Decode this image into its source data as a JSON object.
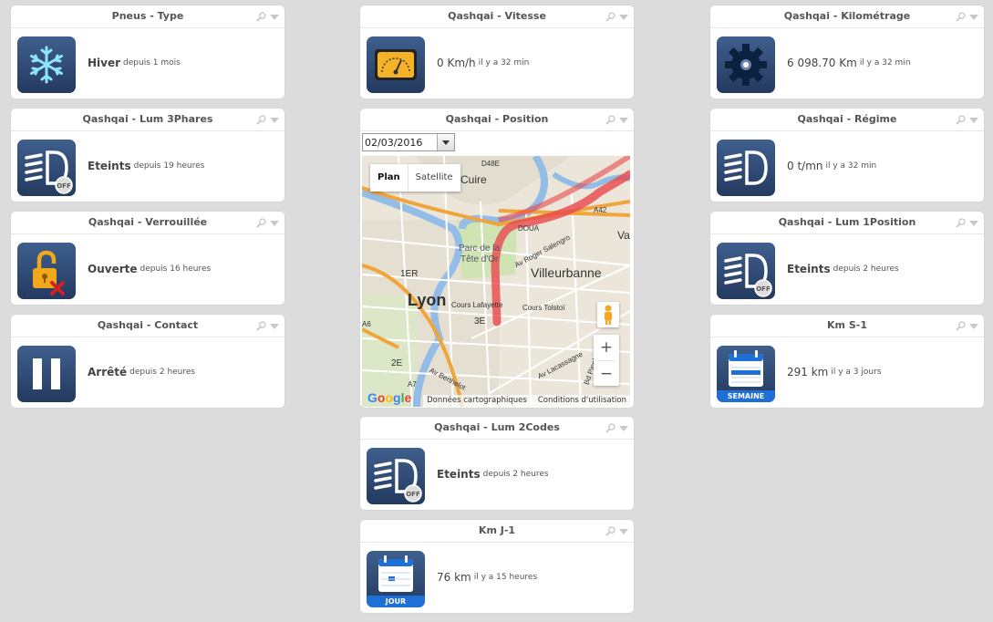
{
  "col1": [
    {
      "title": "Pneus - Type",
      "value": "Hiver",
      "ago": "depuis 1 mois",
      "icon": "snowflake-icon"
    },
    {
      "title": "Qashqai - Lum 3Phares",
      "value": "Eteints",
      "ago": "depuis 19 heures",
      "icon": "headlight-off-icon"
    },
    {
      "title": "Qashqai - Verrouillée",
      "value": "Ouverte",
      "ago": "depuis 16 heures",
      "icon": "unlocked-padlock-icon"
    },
    {
      "title": "Qashqai - Contact",
      "value": "Arrêté",
      "ago": "depuis 2 heures",
      "icon": "pause-icon"
    }
  ],
  "col2": [
    {
      "title": "Qashqai - Vitesse",
      "value": "0 Km/h",
      "ago": "il y a 32 min",
      "icon": "speedometer-icon"
    },
    {
      "title": "Qashqai - Lum 2Codes",
      "value": "Eteints",
      "ago": "depuis 2 heures",
      "icon": "headlight-off-icon"
    },
    {
      "title": "Km J-1",
      "value": "76 km",
      "ago": "il y a 15 heures",
      "icon": "calendar-icon",
      "strip": "JOUR"
    }
  ],
  "col3": [
    {
      "title": "Qashqai - Kilométrage",
      "value": "6 098.70 Km",
      "ago": "il y a 32 min",
      "icon": "gear-icon"
    },
    {
      "title": "Qashqai - Régime",
      "value": "0 t/mn",
      "ago": "il y a 32 min",
      "icon": "headlight-icon"
    },
    {
      "title": "Qashqai - Lum 1Position",
      "value": "Eteints",
      "ago": "depuis 2 heures",
      "icon": "headlight-off-icon"
    },
    {
      "title": "Km S-1",
      "value": "291 km",
      "ago": "il y a 3 jours",
      "icon": "calendar-icon",
      "strip": "SEMAINE"
    }
  ],
  "position": {
    "title": "Qashqai - Position",
    "date": "02/03/2016",
    "map_types": [
      "Plan",
      "Satellite"
    ],
    "zoom_in": "+",
    "zoom_out": "−",
    "labels": {
      "cuire": "-Cuire",
      "parc": "Parc de la",
      "tete": "Tête d'Or",
      "villeurbanne": "Villeurbanne",
      "lyon": "Lyon",
      "ier": "1ER",
      "ive": "3E",
      "iie": "2E",
      "lafayette": "Cours Lafayette",
      "tolstoi": "Cours Tolstoï",
      "salengro": "Av Roger Salengro",
      "lacassagne": "Av Lacassagne",
      "berthelot": "Av Berthelot",
      "pinel": "Bd Pinel",
      "doua": "DOUA",
      "a42": "A42",
      "a7": "A7",
      "a6": "A6",
      "d48e": "D48E",
      "va": "Va"
    },
    "google": "Google",
    "footer": [
      "Données cartographiques",
      "Conditions d'utilisation"
    ]
  },
  "colors": {
    "tile_top": "#3f5f8e",
    "tile_bottom": "#243a5f",
    "route": "#e8474c",
    "strip": "#1e6fd6"
  }
}
